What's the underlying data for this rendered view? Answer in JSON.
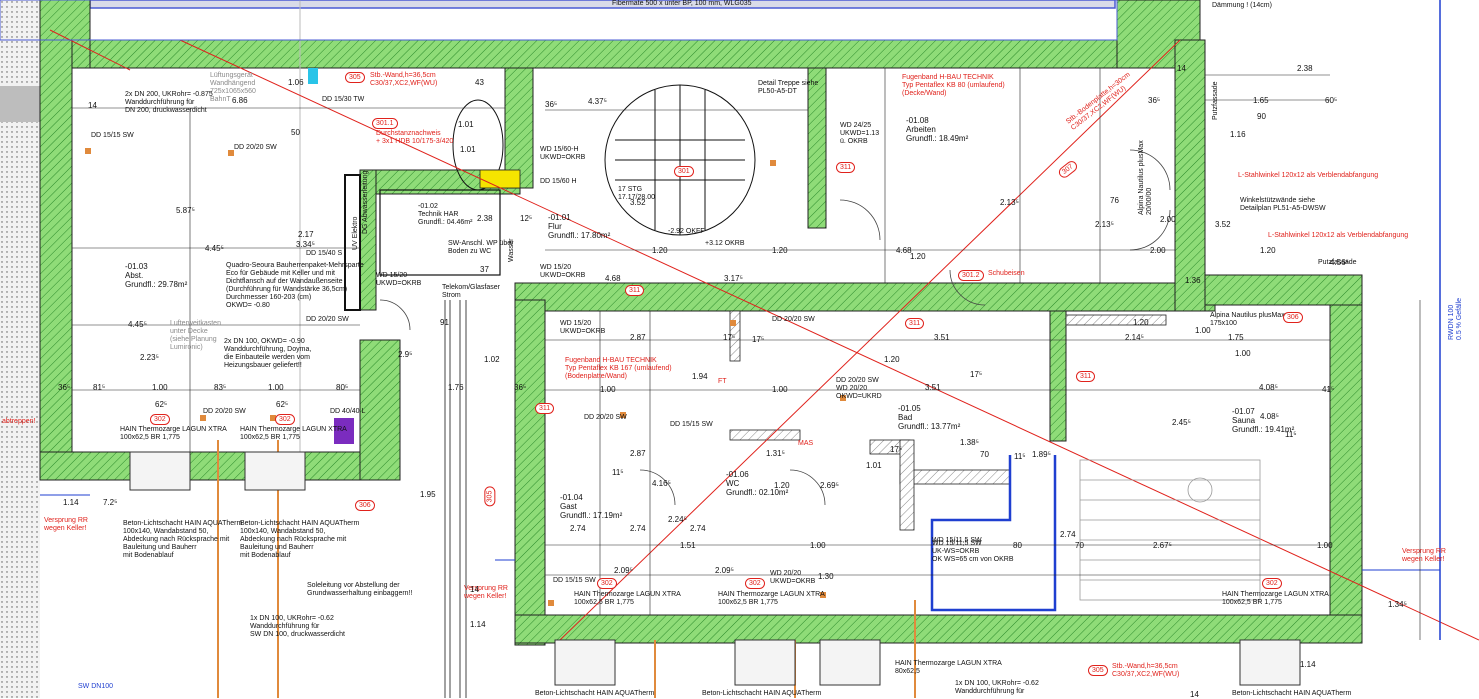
{
  "top": {
    "top_caption": "Fibermate 500 x unter BP, 100 mm, WLG035",
    "daemmung": "Dämmung ! (14cm)"
  },
  "rooms": {
    "r103": {
      "number": "-01.03",
      "name": "Abst.",
      "area": "Grundfl.: 29.78m²"
    },
    "r102": {
      "number": "-01.02",
      "name": "Technik HAR",
      "area": "Grundfl.: 04.46m²"
    },
    "r101": {
      "number": "-01.01",
      "name": "Flur",
      "area": "Grundfl.: 17.80m²"
    },
    "r108": {
      "number": "-01.08",
      "name": "Arbeiten",
      "area": "Grundfl.: 18.49m²"
    },
    "r105": {
      "number": "-01.05",
      "name": "Bad",
      "area": "Grundfl.: 13.77m²"
    },
    "r107": {
      "number": "-01.07",
      "name": "Sauna",
      "area": "Grundfl.: 19.41m²"
    },
    "r106": {
      "number": "-01.06",
      "name": "WC",
      "area": "Grundfl.: 02.10m²"
    },
    "r104": {
      "number": "-01.04",
      "name": "Gast",
      "area": "Grundfl.: 17.19m²"
    }
  },
  "notes": {
    "lueftung": "Lüftungsgerät\nWandhängend\n725x1065x560\nBahnT",
    "dn200": "2x DN 200, UKRohr= -0.875\nWanddurchführung für\nDN 200, druckwasserdicht",
    "quadro": "Quadro-Seoura Bauherrenpaket-Mehrsparte\nEco für Gebäude mit Keller und mit\nDichtflansch auf der Wandaußenseite\n(Durchführung für Wandstärke 36,5cm)\nDurchmesser 160-203 (cm)\nOKWD= -0.80",
    "dn100_mid": "2x DN 100, OKWD= -0.90\nWanddurchführung, Doyma,\ndie Einbauteile werden vom\nHeizungsbauer geliefert!!",
    "lufterwaerm": "Lufterweitkasten\nunter Decke\n(siehe Planung\nLumironic)",
    "telekom": "Telekom/Glasfaser\nStrom",
    "wasser": "Wasser",
    "uv_elektro": "UV Elektro",
    "dg_abwasser": "DG Abwasserleitung",
    "treppe": "Detail Treppe siehe\nPL50-A5-DT",
    "stg": "17 STG\n17.17/28.00",
    "okff": "-2.92 OKFF",
    "okrb": "+3.12 OKRB",
    "fugenband_top": "Fugenband H-BAU TECHNIK\nTyp Pentaflex KB 80 (umlaufend)\n(Decke/Wand)",
    "fugenband_mid": "Fugenband H-BAU TECHNIK\nTyp Pentaflex KB 167 (umlaufend)\n(Bodenplatte/Wand)",
    "lwinkel1": "L-Stahlwinkel 120x12 als Verblendabfangung",
    "lwinkel2": "L-Stahlwinkel 120x12 als Verblendabfangung",
    "winkelstuetz": "Winkelstützwände siehe\nDetailplan PL51-A5-DWSW",
    "alpina_door": "Alpina Nautilus plusMax\n20/00/00",
    "alpina_win": "Alpina Nautilus plusMax\n175x100",
    "putzfassade1": "Putzfassade",
    "putzfassade2": "Putzfassade",
    "schubeisen": "Schubeisen",
    "durchstanz": "Durchstanznachweis\n+ 3x1 HDB 10/175-3/420",
    "wd_15_20": "WD 15/20\nUKWD=OKRB",
    "wd_15_60": "WD 15/60-H\nUKWD=OKRB",
    "hain1": "HAIN Thermozarge LAGUN XTRA\n100x62,5 BR 1,775",
    "hain2": "HAIN Thermozarge LAGUN XTRA\n100x62,5 BR 1,775",
    "hain3": "HAIN Thermozarge LAGUN XTRA\n100x62,5 BR 1,775",
    "hain4": "HAIN Thermozarge LAGUN XTRA\n100x62,5 BR 1,775",
    "hain5": "HAIN Thermozarge LAGUN XTRA\n100x62,5 BR 1,775",
    "hain6": "HAIN Thermozarge LAGUN XTRA\n80x62,5",
    "beton1": "Beton-Lichtschacht HAIN AQUATherm\n100x140, Wandabstand 50,\nAbdeckung nach Rücksprache mit\nBauleitung und Bauherr\nmit Bodenablauf",
    "beton2": "Beton-Lichtschacht HAIN AQUATherm\n100x140, Wandabstand 50,\nAbdeckung nach Rücksprache mit\nBauleitung und Bauherr\nmit Bodenablauf",
    "soleleitung": "Soleleitung vor Abstellung der\nGrundwasserhaltung einbaggern!!",
    "dn100_bottom": "1x DN 100, UKRohr= -0.62\nWanddurchführung für\nSW DN 100, druckwasserdicht",
    "dn100_bottom2": "1x DN 100, UKRohr= -0.62\nWanddurchführung für",
    "versprung_left": "Versprung RR\nwegen Keller!",
    "versprung_mid": "Versprung RR\nwegen Keller!",
    "versprung_right": "Versprung RR\nwegen Keller!",
    "rwdn100": "RWDN 100\n0.5 % Gefälle",
    "sw_dn100": "SW DN100",
    "stb_wand": "Stb.-Wand,h=36,5cm\nC30/37,XC2,WF(WU)",
    "stb_wand_bottom": "Stb.-Wand,h=36,5cm\nC30/37,XC2,WF(WU)",
    "stb_bottom": "Stb.-Bodenplatte,h=30cm\nC30/37,XC2,WF(WU)",
    "uk_ws": "WD 15/11,5 SW\nUK-WS=OKRB\nOK WS=65 cm von OKRB",
    "mas": "MAS",
    "ft": "FT",
    "abtreppen": "abtreppen!",
    "beton_bottom1": "Beton-Lichtschacht HAIN AQUATherm",
    "beton_bottom2": "Beton-Lichtschacht HAIN AQUATherm",
    "beton_bottom3": "Beton-Lichtschacht HAIN AQUATherm"
  },
  "wd_labels": [
    "DD 15/30 TW",
    "DD 15/15 SW",
    "DD 20/20 SW",
    "DD 15/60 H",
    "DD 15/40 S",
    "WD 15/20\nUKWD=OKRB",
    "DD 20/20 SW",
    "WD 15/20\nUKWD=OKRB",
    "DD 20/20 SW",
    "DD 20/20 SW\nWD 20/20\nOKWD=UKRD",
    "DD 20/20 SW",
    "DD 15/15 SW",
    "DD 15/15 SW",
    "DD 20/20 SW",
    "WD 20/20\nUKWD=OKRB",
    "DD 40/40 L",
    "WD 24/25\nUKWD=1.13\nü. OKRB",
    "SW-Anschl. WP über\nBoden zu WC",
    "WD 15/11,5 SW"
  ],
  "tags": [
    "305",
    "301.1",
    "301",
    "311",
    "311",
    "311",
    "311",
    "311",
    "306",
    "306",
    "302",
    "302",
    "302",
    "302",
    "301.2",
    "302",
    "307",
    "305",
    "305"
  ],
  "dims": [
    "2.38",
    "1.65",
    "60⁵",
    "90",
    "14",
    "36⁵",
    "6.86",
    "14",
    "50",
    "1.06",
    "43",
    "4.37⁵",
    "1.01",
    "3.52",
    "5.87⁵",
    "2.38",
    "12⁵",
    "4.45⁵",
    "2.17",
    "4.45⁵",
    "2.23⁵",
    "1.01",
    "81⁵",
    "1.00",
    "83⁵",
    "1.00",
    "80⁵",
    "36⁵",
    "62⁵",
    "62⁵",
    "36⁵",
    "1.76",
    "1.02",
    "1.20",
    "2.87",
    "2.87",
    "4.16⁵",
    "1.94",
    "1.31⁵",
    "1.20",
    "1.01",
    "1.38⁵",
    "2.69⁵",
    "4.08⁵",
    "4.08⁵",
    "3.51",
    "3.51",
    "2.14⁵",
    "1.75",
    "1.00",
    "1.20",
    "2.67⁵",
    "2.74",
    "2.74",
    "2.74",
    "1.51",
    "2.09⁵",
    "2.09⁵",
    "1.00",
    "1.00",
    "1.00",
    "1.30",
    "80",
    "1.89⁵",
    "70",
    "70",
    "1.00",
    "41⁵",
    "36⁵",
    "17⁵",
    "17⁵",
    "17⁵",
    "11⁵",
    "11⁵",
    "11⁵",
    "4.68",
    "4.68",
    "3.17⁵",
    "1.20",
    "76",
    "1.20",
    "2.13⁵",
    "2.13⁵",
    "3.52",
    "2.00",
    "2.00",
    "1.36",
    "1.20",
    "1.00",
    "1.20",
    "1.95",
    "4.56⁵",
    "17⁵",
    "2.24⁵",
    "2.74",
    "2.45⁵",
    "1.34⁵",
    "1.14",
    "14",
    "14",
    "1.14",
    "1.14",
    "7.2⁵",
    "2.9⁵",
    "37",
    "91",
    "1.16",
    "3.34⁵",
    "2.17"
  ],
  "stair": {
    "label": "301"
  },
  "colors": {
    "wall_green": "#7ed36b",
    "red_line": "#e0221c",
    "blue": "#1f3fd0",
    "orange": "#e08a3c",
    "purple": "#7b2cbf",
    "yellow": "#f5e400",
    "cyan": "#29c4e8"
  }
}
